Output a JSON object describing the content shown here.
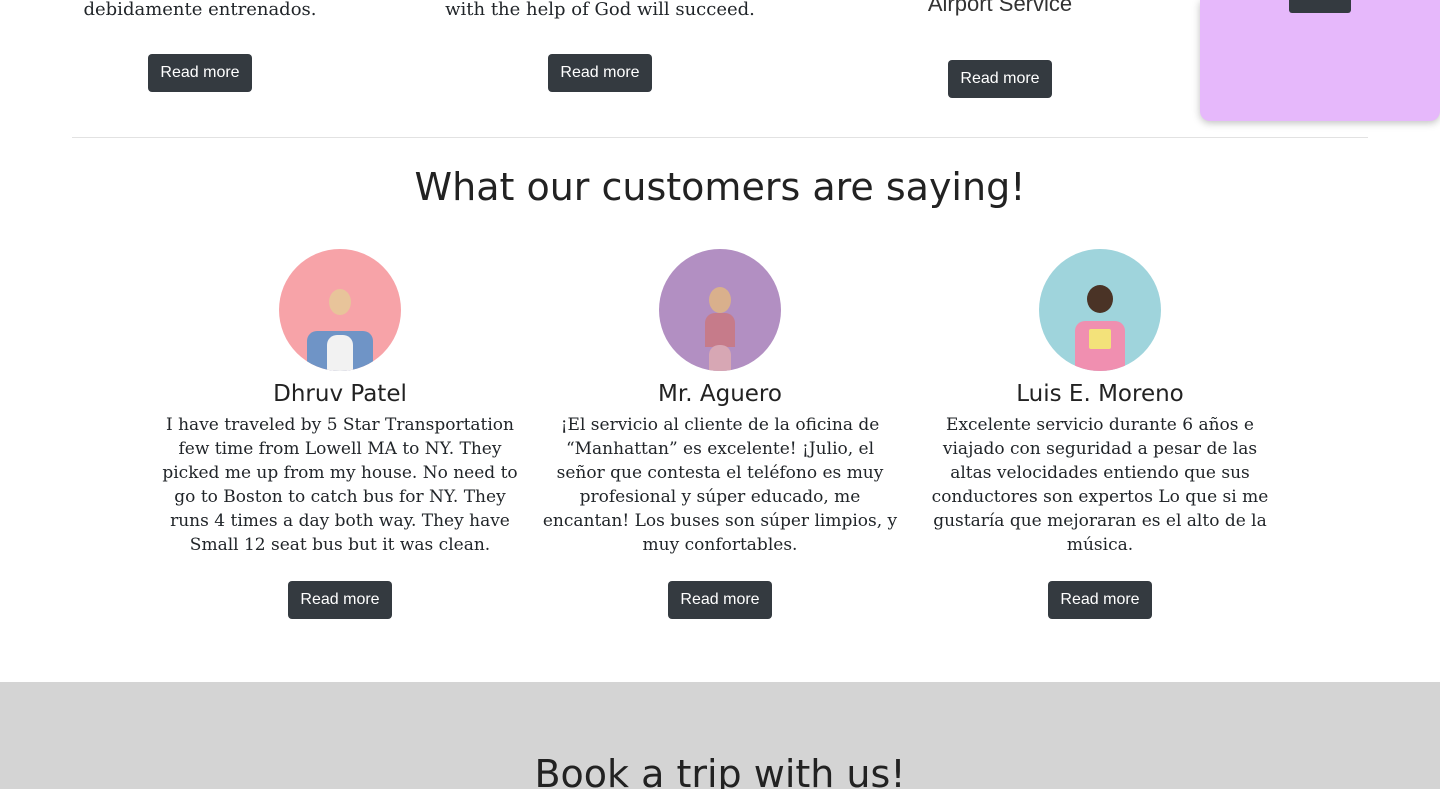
{
  "top_cards": [
    {
      "text": "debidamente entrenados.",
      "button": "Read more"
    },
    {
      "text": "with the help of God will succeed.",
      "button": "Read more"
    },
    {
      "text": "Airport Service",
      "button": "Read more"
    }
  ],
  "section": {
    "title": "What our customers are saying!"
  },
  "testimonials": [
    {
      "name": "Dhruv Patel",
      "quote": "I have traveled by 5 Star Transportation few time from Lowell MA to NY. They picked me up from my house. No need to go to Boston to catch bus for NY. They runs 4 times a day both way. They have Small 12 seat bus but it was clean.",
      "button": "Read more",
      "avatar_color": "#f7a3a8",
      "avatar_icon": "person-avatar-icon"
    },
    {
      "name": "Mr. Aguero",
      "quote": "¡El servicio al cliente de la oficina de “Manhattan” es excelente! ¡Julio, el señor que contesta el teléfono es muy profesional y súper educado, me encantan! Los buses son súper limpios, y muy confortables.",
      "button": "Read more",
      "avatar_color": "#b28fc2",
      "avatar_icon": "person-avatar-icon"
    },
    {
      "name": "Luis E. Moreno",
      "quote": "Excelente servicio durante 6 años e viajado con seguridad a pesar de las altas velocidades entiendo que sus conductores son expertos Lo que si me gustaría que mejoraran es el alto de la música.",
      "button": "Read more",
      "avatar_color": "#9fd4dc",
      "avatar_icon": "person-avatar-icon"
    }
  ],
  "booking": {
    "title": "Book a trip with us!"
  },
  "colors": {
    "button_bg": "#343a40",
    "panel_bg": "#e6b8fb",
    "band_bg": "#d4d4d4"
  }
}
